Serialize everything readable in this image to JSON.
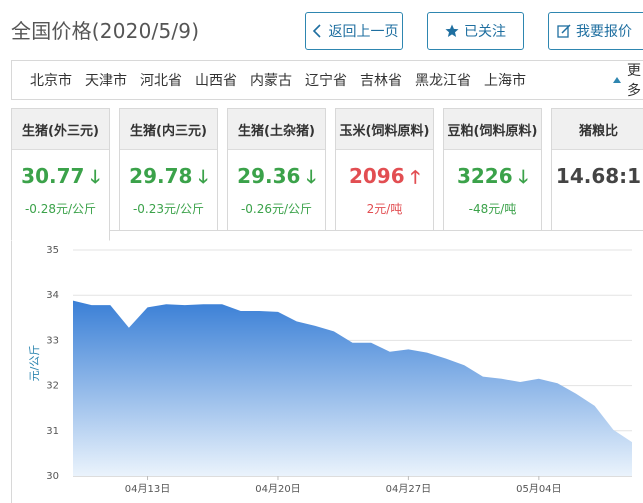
{
  "page": {
    "title": "全国价格(2020/5/9)"
  },
  "toolbar": {
    "back_label": "返回上一页",
    "follow_label": "已关注",
    "report_label": "我要报价"
  },
  "regions": {
    "items": [
      "北京市",
      "天津市",
      "河北省",
      "山西省",
      "内蒙古",
      "辽宁省",
      "吉林省",
      "黑龙江省",
      "上海市"
    ],
    "more_label": "更多"
  },
  "cards": [
    {
      "name": "生猪(外三元)",
      "value": "30.77",
      "direction": "down",
      "change": "-0.28元/公斤"
    },
    {
      "name": "生猪(内三元)",
      "value": "29.78",
      "direction": "down",
      "change": "-0.23元/公斤"
    },
    {
      "name": "生猪(土杂猪)",
      "value": "29.36",
      "direction": "down",
      "change": "-0.26元/公斤"
    },
    {
      "name": "玉米(饲料原料)",
      "value": "2096",
      "direction": "up",
      "change": "2元/吨"
    },
    {
      "name": "豆粕(饲料原料)",
      "value": "3226",
      "direction": "down",
      "change": "-48元/吨"
    },
    {
      "name": "猪粮比",
      "value": "14.68:1",
      "direction": "none",
      "change": ""
    }
  ],
  "colors": {
    "accent": "#2e86b0",
    "down": "#3ba24a",
    "up": "#e24e52",
    "area_top": "#3a7fd6",
    "area_bottom": "#eaf3fc"
  },
  "chart_data": {
    "type": "area",
    "ylabel": "元/公斤",
    "ylim": [
      30,
      35
    ],
    "yticks": [
      30,
      31,
      32,
      33,
      34,
      35
    ],
    "xticks": [
      "04月13日",
      "04月20日",
      "04月27日",
      "05月04日"
    ],
    "grid": true,
    "x": [
      "04月09日",
      "04月10日",
      "04月11日",
      "04月12日",
      "04月13日",
      "04月14日",
      "04月15日",
      "04月16日",
      "04月17日",
      "04月18日",
      "04月19日",
      "04月20日",
      "04月21日",
      "04月22日",
      "04月23日",
      "04月24日",
      "04月25日",
      "04月26日",
      "04月27日",
      "04月28日",
      "04月29日",
      "04月30日",
      "05月01日",
      "05月02日",
      "05月03日",
      "05月04日",
      "05月05日",
      "05月06日",
      "05月07日",
      "05月08日",
      "05月09日"
    ],
    "values": [
      33.88,
      33.78,
      33.78,
      33.28,
      33.73,
      33.8,
      33.78,
      33.8,
      33.8,
      33.65,
      33.65,
      33.63,
      33.42,
      33.32,
      33.2,
      32.95,
      32.95,
      32.75,
      32.8,
      32.73,
      32.6,
      32.45,
      32.2,
      32.15,
      32.08,
      32.15,
      32.05,
      31.82,
      31.55,
      31.02,
      30.75
    ]
  }
}
